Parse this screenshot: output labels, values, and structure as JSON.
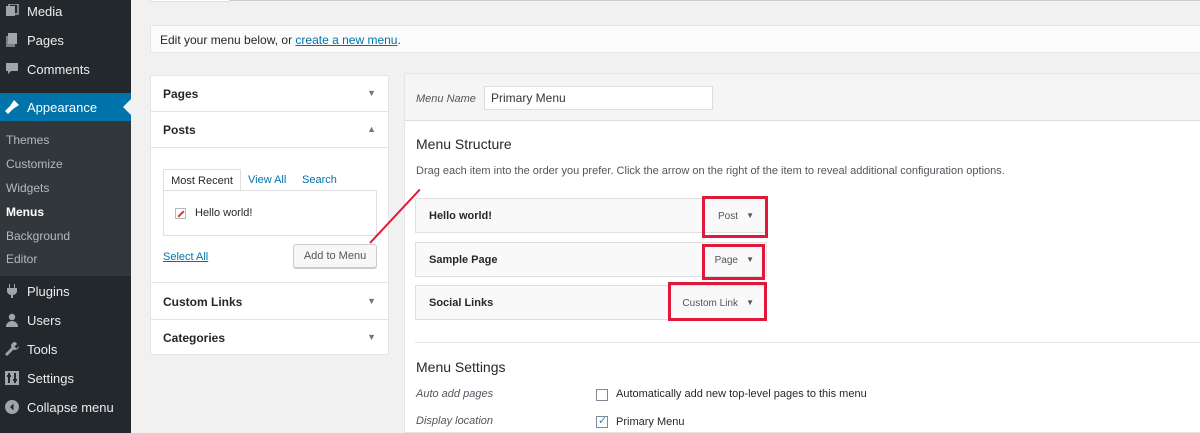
{
  "sidebar": {
    "items": [
      {
        "label": "Media",
        "icon": "media-icon"
      },
      {
        "label": "Pages",
        "icon": "pages-icon"
      },
      {
        "label": "Comments",
        "icon": "comments-icon"
      },
      {
        "label": "Appearance",
        "icon": "appearance-icon",
        "active": true
      },
      {
        "label": "Plugins",
        "icon": "plugins-icon"
      },
      {
        "label": "Users",
        "icon": "users-icon"
      },
      {
        "label": "Tools",
        "icon": "tools-icon"
      },
      {
        "label": "Settings",
        "icon": "settings-icon"
      },
      {
        "label": "Collapse menu",
        "icon": "collapse-icon"
      }
    ],
    "submenu": [
      "Themes",
      "Customize",
      "Widgets",
      "Menus",
      "Background",
      "Editor"
    ],
    "current_submenu": "Menus",
    "active_color": "#0073aa"
  },
  "notice": {
    "text": "Edit your menu below, or ",
    "link": "create a new menu",
    "suffix": "."
  },
  "accordion": {
    "pages": "Pages",
    "posts": "Posts",
    "custom_links": "Custom Links",
    "categories": "Categories",
    "tabs": [
      "Most Recent",
      "View All",
      "Search"
    ],
    "post_item": "Hello world!",
    "select_all": "Select All",
    "add_button": "Add to Menu"
  },
  "menu_editor": {
    "name_label": "Menu Name",
    "name_value": "Primary Menu",
    "structure_title": "Menu Structure",
    "instructions": "Drag each item into the order you prefer. Click the arrow on the right of the item to reveal additional configuration options.",
    "items": [
      {
        "title": "Hello world!",
        "type": "Post"
      },
      {
        "title": "Sample Page",
        "type": "Page"
      },
      {
        "title": "Social Links",
        "type": "Custom Link"
      }
    ]
  },
  "menu_settings": {
    "title": "Menu Settings",
    "auto_add_label": "Auto add pages",
    "auto_add_text": "Automatically add new top-level pages to this menu",
    "auto_add_checked": false,
    "location_label": "Display location",
    "location_text": "Primary Menu",
    "location_checked": true
  },
  "annotation_color": "#e0183a"
}
